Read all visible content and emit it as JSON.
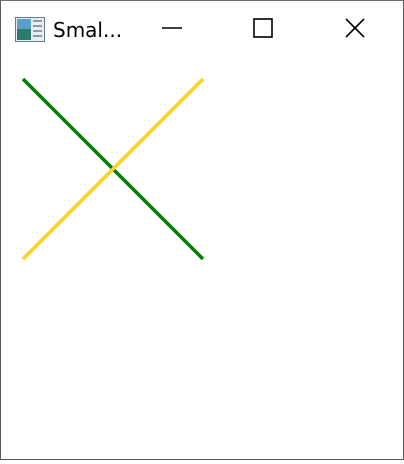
{
  "window": {
    "title": "Smal...",
    "app_icon": "window-app-icon"
  },
  "caption_buttons": {
    "minimize_icon": "minimize-icon",
    "maximize_icon": "maximize-icon",
    "close_icon": "close-icon"
  },
  "canvas": {
    "lines": [
      {
        "name": "green-diagonal-line",
        "color": "#008000"
      },
      {
        "name": "yellow-diagonal-line",
        "color": "#FFD21F"
      }
    ]
  }
}
